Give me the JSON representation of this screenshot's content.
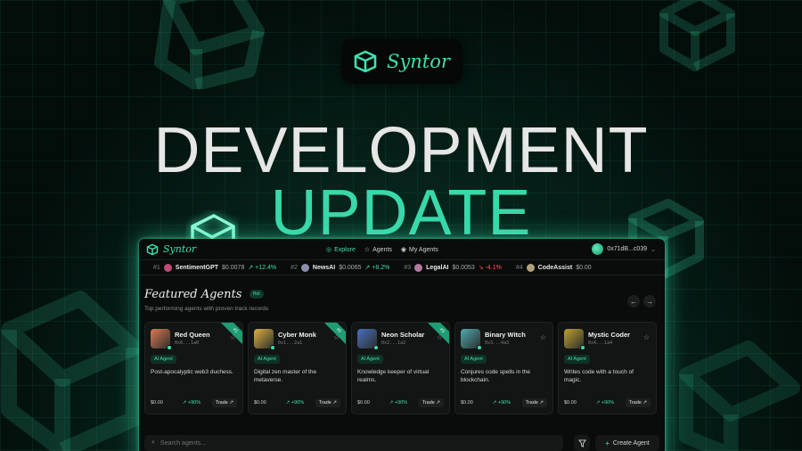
{
  "brand": {
    "name": "Syntor"
  },
  "headline": {
    "line1": "DEVELOPMENT",
    "line2": "UPDATE"
  },
  "nav": {
    "brand": "Syntor",
    "links": [
      {
        "label": "Explore",
        "icon": "compass-icon",
        "active": true
      },
      {
        "label": "Agents",
        "icon": "star-icon",
        "active": false
      },
      {
        "label": "My Agents",
        "icon": "user-circle-icon",
        "active": false
      }
    ],
    "wallet": "0x71dB...c039"
  },
  "ticker": [
    {
      "rank": "#1",
      "name": "SentimentGPT",
      "price": "$0.0078",
      "change": "+12.4%",
      "dir": "up",
      "color": "#c04a7a"
    },
    {
      "rank": "#2",
      "name": "NewsAI",
      "price": "$0.0065",
      "change": "+8.2%",
      "dir": "up",
      "color": "#8a8fb0"
    },
    {
      "rank": "#3",
      "name": "LegalAI",
      "price": "$0.0053",
      "change": "-4.1%",
      "dir": "down",
      "color": "#b07a9a"
    },
    {
      "rank": "#4",
      "name": "CodeAssist",
      "price": "$0.00",
      "change": "",
      "dir": "up",
      "color": "#b0a07a"
    }
  ],
  "featured": {
    "title": "Featured Agents",
    "badge": "Hot",
    "subtitle": "Top performing agents with proven track records"
  },
  "cards": [
    {
      "name": "Red Queen",
      "addr": "0x8...1a0",
      "rank": "#1",
      "tag": "AI Agent",
      "desc": "Post-apocalyptic web3 duchess.",
      "price": "$0.00",
      "change": "+90%",
      "trade": "Trade",
      "color": "#e07850"
    },
    {
      "name": "Cyber Monk",
      "addr": "0x1...2a1",
      "rank": "#2",
      "tag": "AI Agent",
      "desc": "Digital zen master of the metaverse.",
      "price": "$0.00",
      "change": "+90%",
      "trade": "Trade",
      "color": "#e0b040"
    },
    {
      "name": "Neon Scholar",
      "addr": "0x2...1a2",
      "rank": "#3",
      "tag": "AI Agent",
      "desc": "Knowledge keeper of virtual realms.",
      "price": "$0.00",
      "change": "+90%",
      "trade": "Trade",
      "color": "#4a70c0"
    },
    {
      "name": "Binary Witch",
      "addr": "0x3...4a3",
      "rank": "",
      "tag": "AI Agent",
      "desc": "Conjures code spells in the blockchain.",
      "price": "$0.00",
      "change": "+90%",
      "trade": "Trade",
      "color": "#50a8b0"
    },
    {
      "name": "Mystic Coder",
      "addr": "0x4...1a4",
      "rank": "",
      "tag": "AI Agent",
      "desc": "Writes code with a touch of magic.",
      "price": "$0.00",
      "change": "+90%",
      "trade": "Trade",
      "color": "#c0a030"
    }
  ],
  "search": {
    "placeholder": "Search agents..."
  },
  "create": {
    "label": "Create Agent"
  },
  "colors": {
    "accent": "#3ee0b0",
    "negative": "#ff5a5a",
    "panel": "#0a0b0b"
  }
}
